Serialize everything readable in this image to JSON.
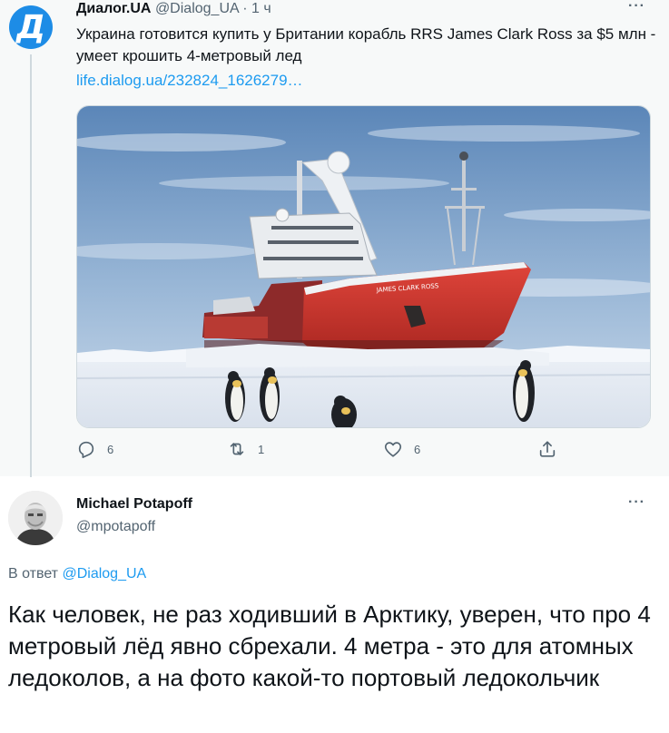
{
  "quoted_tweet": {
    "avatar_letter": "Д",
    "author_name": "Диалог.UA",
    "author_handle": "@Dialog_UA",
    "separator": "·",
    "time_ago": "1 ч",
    "text": "Украина готовится купить у Британии корабль RRS James Clark Ross за $5 млн - умеет крошить 4-метровый лед",
    "link": "life.dialog.ua/232824_1626279…",
    "image": {
      "ship_name": "JAMES CLARK ROSS"
    },
    "stats": {
      "replies": "6",
      "retweets": "1",
      "likes": "6"
    },
    "more_icon": "more-dots-icon"
  },
  "reply_tweet": {
    "author_name": "Michael Potapoff",
    "author_handle": "@mpotapoff",
    "reply_prefix": "В ответ",
    "reply_target": "@Dialog_UA",
    "text": "Как человек, не раз ходивший в Арктику, уверен, что про 4 метровый лёд явно сбрехали. 4 метра - это для атомных ледоколов, а на фото какой-то портовый ледокольчик"
  },
  "colors": {
    "accent": "#1d9bf0",
    "muted": "#536471",
    "avatar_blue": "#1d8ce6",
    "hull_red": "#d7322b"
  }
}
